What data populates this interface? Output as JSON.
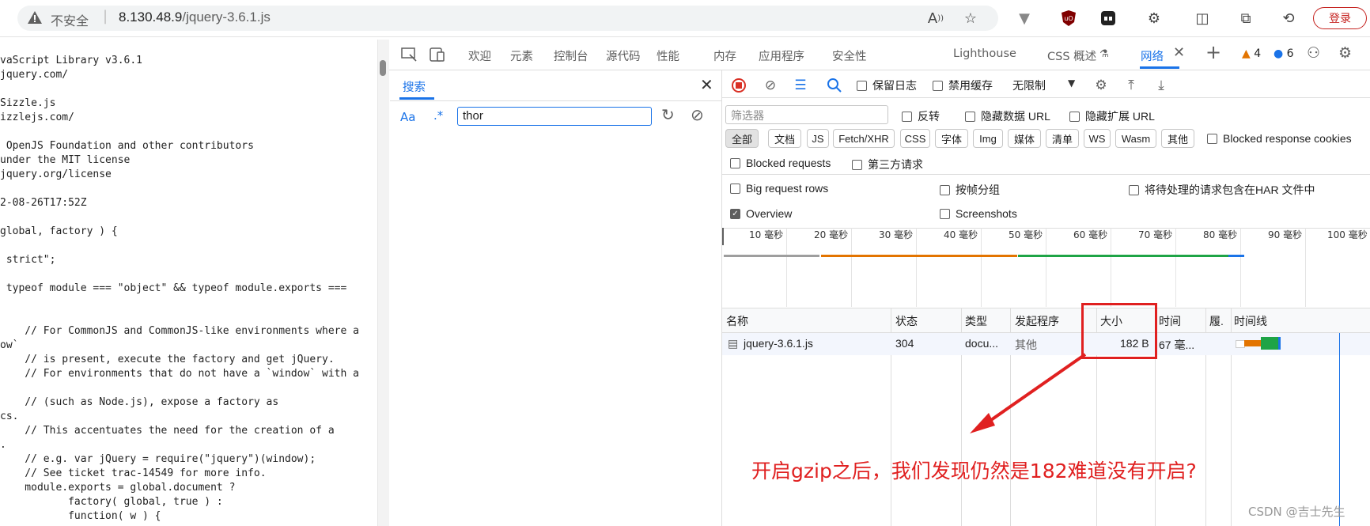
{
  "browser": {
    "security_label": "不安全",
    "url_host": "8.130.48.9",
    "url_path": "/jquery-3.6.1.js",
    "login_label": "登录"
  },
  "source": {
    "lines": [
      "",
      "vaScript Library v3.6.1",
      "jquery.com/",
      "",
      "Sizzle.js",
      "izzlejs.com/",
      "",
      " OpenJS Foundation and other contributors",
      "under the MIT license",
      "jquery.org/license",
      "",
      "2-08-26T17:52Z",
      "",
      "global, factory ) {",
      "",
      " strict\";",
      "",
      " typeof module === \"object\" && typeof module.exports ===",
      "",
      "",
      "    // For CommonJS and CommonJS-like environments where a",
      "ow`",
      "    // is present, execute the factory and get jQuery.",
      "    // For environments that do not have a `window` with a",
      "",
      "    // (such as Node.js), expose a factory as",
      "cs.",
      "    // This accentuates the need for the creation of a",
      ".",
      "    // e.g. var jQuery = require(\"jquery\")(window);",
      "    // See ticket trac-14549 for more info.",
      "    module.exports = global.document ?",
      "           factory( global, true ) :",
      "           function( w ) {"
    ]
  },
  "devtools": {
    "tabs": [
      "欢迎",
      "元素",
      "控制台",
      "源代码",
      "性能",
      "内存",
      "应用程序",
      "安全性",
      "Lighthouse",
      "CSS 概述",
      "网络"
    ],
    "warnings_count": "4",
    "issues_count": "6"
  },
  "search": {
    "tab_label": "搜索",
    "match_case_label": "Aa",
    "regex_label": ".*",
    "query": "thor"
  },
  "network": {
    "preserve_log": "保留日志",
    "disable_cache": "禁用缓存",
    "throttle": "无限制",
    "filter_placeholder": "筛选器",
    "invert": "反转",
    "hide_data_urls": "隐藏数据 URL",
    "hide_ext_urls": "隐藏扩展 URL",
    "chips": [
      "全部",
      "文档",
      "JS",
      "Fetch/XHR",
      "CSS",
      "字体",
      "Img",
      "媒体",
      "清单",
      "WS",
      "Wasm",
      "其他"
    ],
    "blocked_cookies": "Blocked response cookies",
    "blocked_requests": "Blocked requests",
    "third_party": "第三方请求",
    "big_rows": "Big request rows",
    "group_by_frame": "按帧分组",
    "har_pending": "将待处理的请求包含在HAR 文件中",
    "overview": "Overview",
    "screenshots": "Screenshots",
    "timeline_ticks": [
      "10 毫秒",
      "20 毫秒",
      "30 毫秒",
      "40 毫秒",
      "50 毫秒",
      "60 毫秒",
      "70 毫秒",
      "80 毫秒",
      "90 毫秒",
      "100 毫秒"
    ],
    "columns": [
      "名称",
      "状态",
      "类型",
      "发起程序",
      "大小",
      "时间",
      "履.",
      "时间线"
    ],
    "row": {
      "name": "jquery-3.6.1.js",
      "status": "304",
      "type": "docu...",
      "initiator": "其他",
      "size": "182 B",
      "time": "67 毫..."
    }
  },
  "annotation": {
    "text": "开启gzip之后，我们发现仍然是182难道没有开启?",
    "color": "#e02020"
  },
  "watermark": "CSDN @吉士先生"
}
